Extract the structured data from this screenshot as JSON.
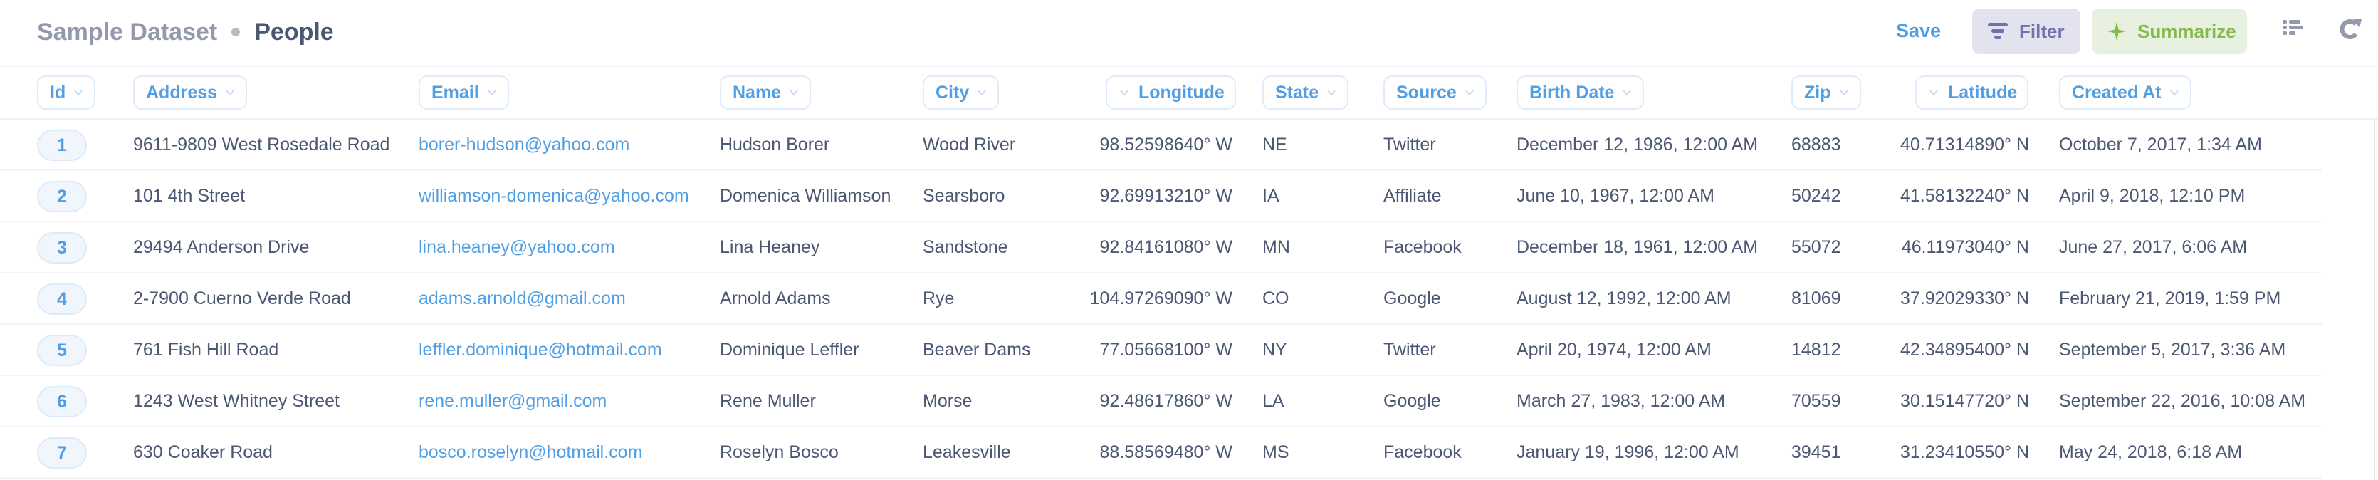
{
  "header": {
    "dataset": "Sample Dataset",
    "table": "People",
    "save_label": "Save",
    "filter_label": "Filter",
    "summarize_label": "Summarize",
    "icons": {
      "filter": "filter-icon",
      "summarize": "sparkle-icon",
      "settings": "notebook-editor-icon",
      "refresh": "refresh-icon"
    },
    "colors": {
      "accent": "#509ee3",
      "filter_bg": "#e2e3ef",
      "filter_fg": "#7172ad",
      "summarize_bg": "#e8f1df",
      "summarize_fg": "#84bb4c"
    }
  },
  "columns": [
    {
      "key": "id",
      "label": "Id"
    },
    {
      "key": "address",
      "label": "Address"
    },
    {
      "key": "email",
      "label": "Email"
    },
    {
      "key": "name",
      "label": "Name"
    },
    {
      "key": "city",
      "label": "City"
    },
    {
      "key": "longitude",
      "label": "Longitude"
    },
    {
      "key": "state",
      "label": "State"
    },
    {
      "key": "source",
      "label": "Source"
    },
    {
      "key": "birth_date",
      "label": "Birth Date"
    },
    {
      "key": "zip",
      "label": "Zip"
    },
    {
      "key": "latitude",
      "label": "Latitude"
    },
    {
      "key": "created_at",
      "label": "Created At"
    }
  ],
  "rows": [
    {
      "id": "1",
      "address": "9611-9809 West Rosedale Road",
      "email": "borer-hudson@yahoo.com",
      "name": "Hudson Borer",
      "city": "Wood River",
      "longitude": "98.52598640° W",
      "state": "NE",
      "source": "Twitter",
      "birth_date": "December 12, 1986, 12:00 AM",
      "zip": "68883",
      "latitude": "40.71314890° N",
      "created_at": "October 7, 2017, 1:34 AM"
    },
    {
      "id": "2",
      "address": "101 4th Street",
      "email": "williamson-domenica@yahoo.com",
      "name": "Domenica Williamson",
      "city": "Searsboro",
      "longitude": "92.69913210° W",
      "state": "IA",
      "source": "Affiliate",
      "birth_date": "June 10, 1967, 12:00 AM",
      "zip": "50242",
      "latitude": "41.58132240° N",
      "created_at": "April 9, 2018, 12:10 PM"
    },
    {
      "id": "3",
      "address": "29494 Anderson Drive",
      "email": "lina.heaney@yahoo.com",
      "name": "Lina Heaney",
      "city": "Sandstone",
      "longitude": "92.84161080° W",
      "state": "MN",
      "source": "Facebook",
      "birth_date": "December 18, 1961, 12:00 AM",
      "zip": "55072",
      "latitude": "46.11973040° N",
      "created_at": "June 27, 2017, 6:06 AM"
    },
    {
      "id": "4",
      "address": "2-7900 Cuerno Verde Road",
      "email": "adams.arnold@gmail.com",
      "name": "Arnold Adams",
      "city": "Rye",
      "longitude": "104.97269090° W",
      "state": "CO",
      "source": "Google",
      "birth_date": "August 12, 1992, 12:00 AM",
      "zip": "81069",
      "latitude": "37.92029330° N",
      "created_at": "February 21, 2019, 1:59 PM"
    },
    {
      "id": "5",
      "address": "761 Fish Hill Road",
      "email": "leffler.dominique@hotmail.com",
      "name": "Dominique Leffler",
      "city": "Beaver Dams",
      "longitude": "77.05668100° W",
      "state": "NY",
      "source": "Twitter",
      "birth_date": "April 20, 1974, 12:00 AM",
      "zip": "14812",
      "latitude": "42.34895400° N",
      "created_at": "September 5, 2017, 3:36 AM"
    },
    {
      "id": "6",
      "address": "1243 West Whitney Street",
      "email": "rene.muller@gmail.com",
      "name": "Rene Muller",
      "city": "Morse",
      "longitude": "92.48617860° W",
      "state": "LA",
      "source": "Google",
      "birth_date": "March 27, 1983, 12:00 AM",
      "zip": "70559",
      "latitude": "30.15147720° N",
      "created_at": "September 22, 2016, 10:08 AM"
    },
    {
      "id": "7",
      "address": "630 Coaker Road",
      "email": "bosco.roselyn@hotmail.com",
      "name": "Roselyn Bosco",
      "city": "Leakesville",
      "longitude": "88.58569480° W",
      "state": "MS",
      "source": "Facebook",
      "birth_date": "January 19, 1996, 12:00 AM",
      "zip": "39451",
      "latitude": "31.23410550° N",
      "created_at": "May 24, 2018, 6:18 AM"
    }
  ]
}
